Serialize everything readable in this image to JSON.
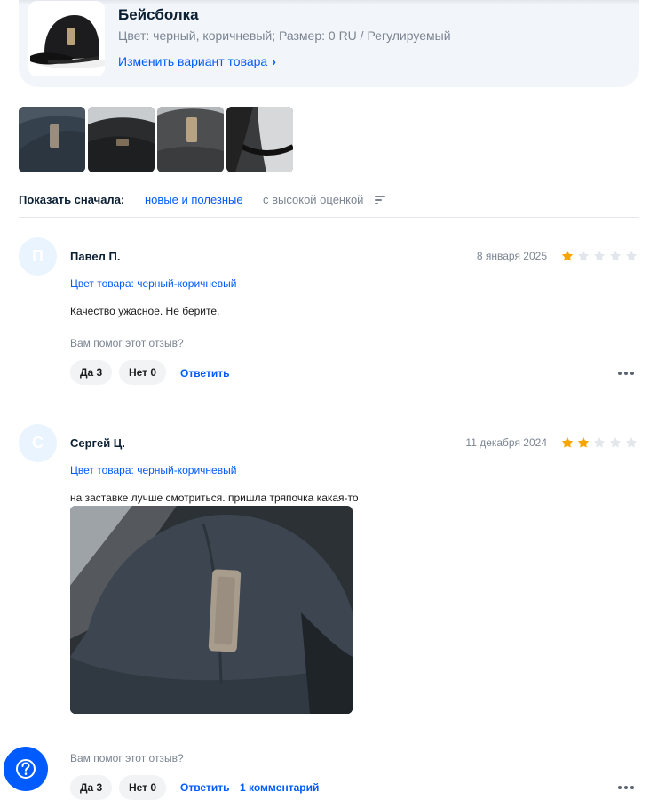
{
  "product": {
    "title": "Бейсболка",
    "variant": "Цвет: черный, коричневый; Размер: 0 RU / Регулируемый",
    "change_link": "Изменить вариант товара"
  },
  "gallery": {
    "count": 4
  },
  "sort": {
    "label": "Показать сначала:",
    "option_active": "новые и полезные",
    "option_other": "с высокой оценкой"
  },
  "reviews": [
    {
      "avatar_letter": "П",
      "author": "Павел П.",
      "date": "8 января 2025",
      "rating": 1,
      "variant": "Цвет товара: черный-коричневый",
      "text": "Качество ужасное. Не берите.",
      "helpful_question": "Вам помог этот отзыв?",
      "yes_label": "Да 3",
      "no_label": "Нет 0",
      "reply_label": "Ответить"
    },
    {
      "avatar_letter": "С",
      "author": "Сергей Ц.",
      "date": "11 декабря 2024",
      "rating": 2,
      "variant": "Цвет товара: черный-коричневый",
      "text": "на заставке лучше смотриться. пришла тряпочка какая-то",
      "helpful_question": "Вам помог этот отзыв?",
      "yes_label": "Да 3",
      "no_label": "Нет 0",
      "reply_label": "Ответить",
      "comments_label": "1 комментарий"
    }
  ],
  "colors": {
    "accent": "#005bff",
    "star_filled": "#f9a500",
    "star_empty": "#e3e7ec",
    "muted_text": "#7b8592",
    "card_bg": "#f2f5f9"
  },
  "icons": {
    "chevron": "chevron-right-icon",
    "sort": "sort-icon",
    "more": "more-dots-icon",
    "help": "question-circle-icon",
    "star": "star-icon"
  }
}
